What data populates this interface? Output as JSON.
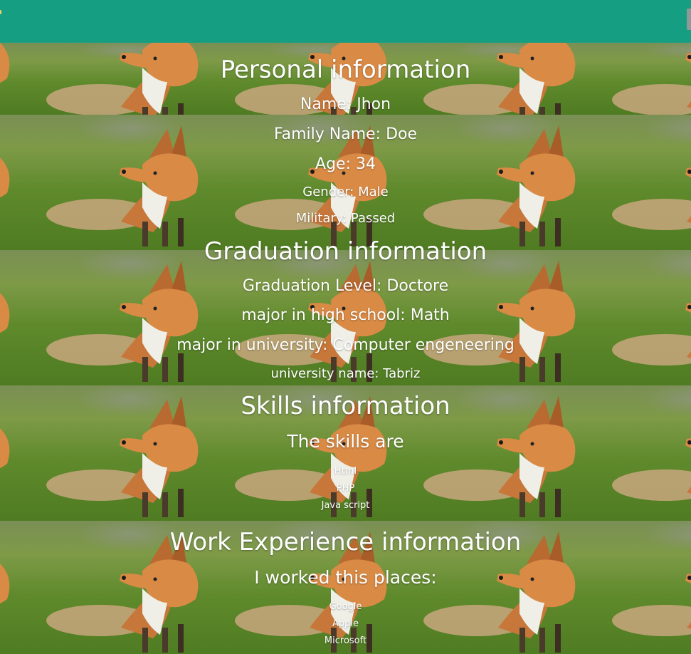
{
  "header": {
    "bar_color": "#159e82"
  },
  "personal": {
    "title": "Personal information",
    "name": "Name: Jhon",
    "family": "Family Name: Doe",
    "age": "Age: 34",
    "gender": "Gender: Male",
    "military": "Military: Passed"
  },
  "graduation": {
    "title": "Graduation information",
    "level": "Graduation Level: Doctore",
    "high_school": "major in high school: Math",
    "university_major": "major in university: Computer engeneering",
    "university_name": "university name: Tabriz"
  },
  "skills": {
    "title": "Skills information",
    "subtitle": "The skills are",
    "items": [
      "Html",
      "PHP",
      "Java script"
    ]
  },
  "work": {
    "title": "Work Experience information",
    "subtitle": "I worked this places:",
    "items": [
      "Google",
      "Apple",
      "Microsoft"
    ]
  },
  "background": {
    "image_icon": "fox-photo-icon"
  }
}
